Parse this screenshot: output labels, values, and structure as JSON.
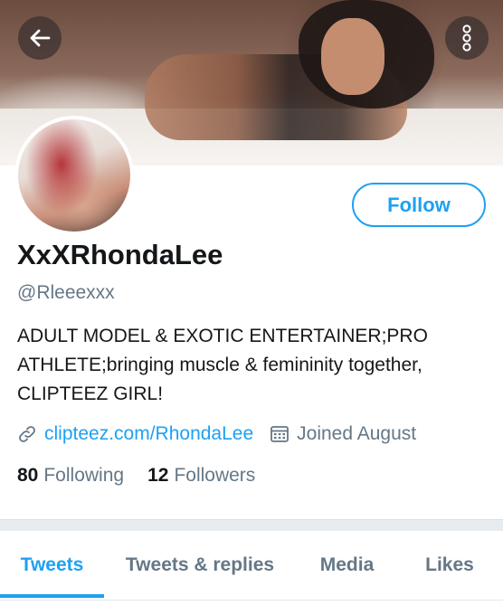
{
  "profile": {
    "display_name": "XxXRhondaLee",
    "handle": "@Rleeexxx",
    "bio_lines": [
      "ADULT MODEL & EXOTIC ENTERTAINER;PRO",
      "ATHLETE;bringing muscle & femininity together,",
      "CLIPTEEZ GIRL!"
    ],
    "website": "clipteez.com/RhondaLee",
    "joined": "Joined August",
    "following_count": "80",
    "following_label": "Following",
    "followers_count": "12",
    "followers_label": "Followers"
  },
  "actions": {
    "follow_label": "Follow"
  },
  "tabs": [
    {
      "label": "Tweets",
      "active": true
    },
    {
      "label": "Tweets & replies",
      "active": false
    },
    {
      "label": "Media",
      "active": false
    },
    {
      "label": "Likes",
      "active": false
    }
  ],
  "icons": {
    "back": "back-arrow-icon",
    "more": "more-vertical-icon",
    "link": "link-icon",
    "calendar": "calendar-icon"
  },
  "colors": {
    "accent": "#1da1f2",
    "secondary_text": "#657786",
    "primary_text": "#14171a"
  }
}
